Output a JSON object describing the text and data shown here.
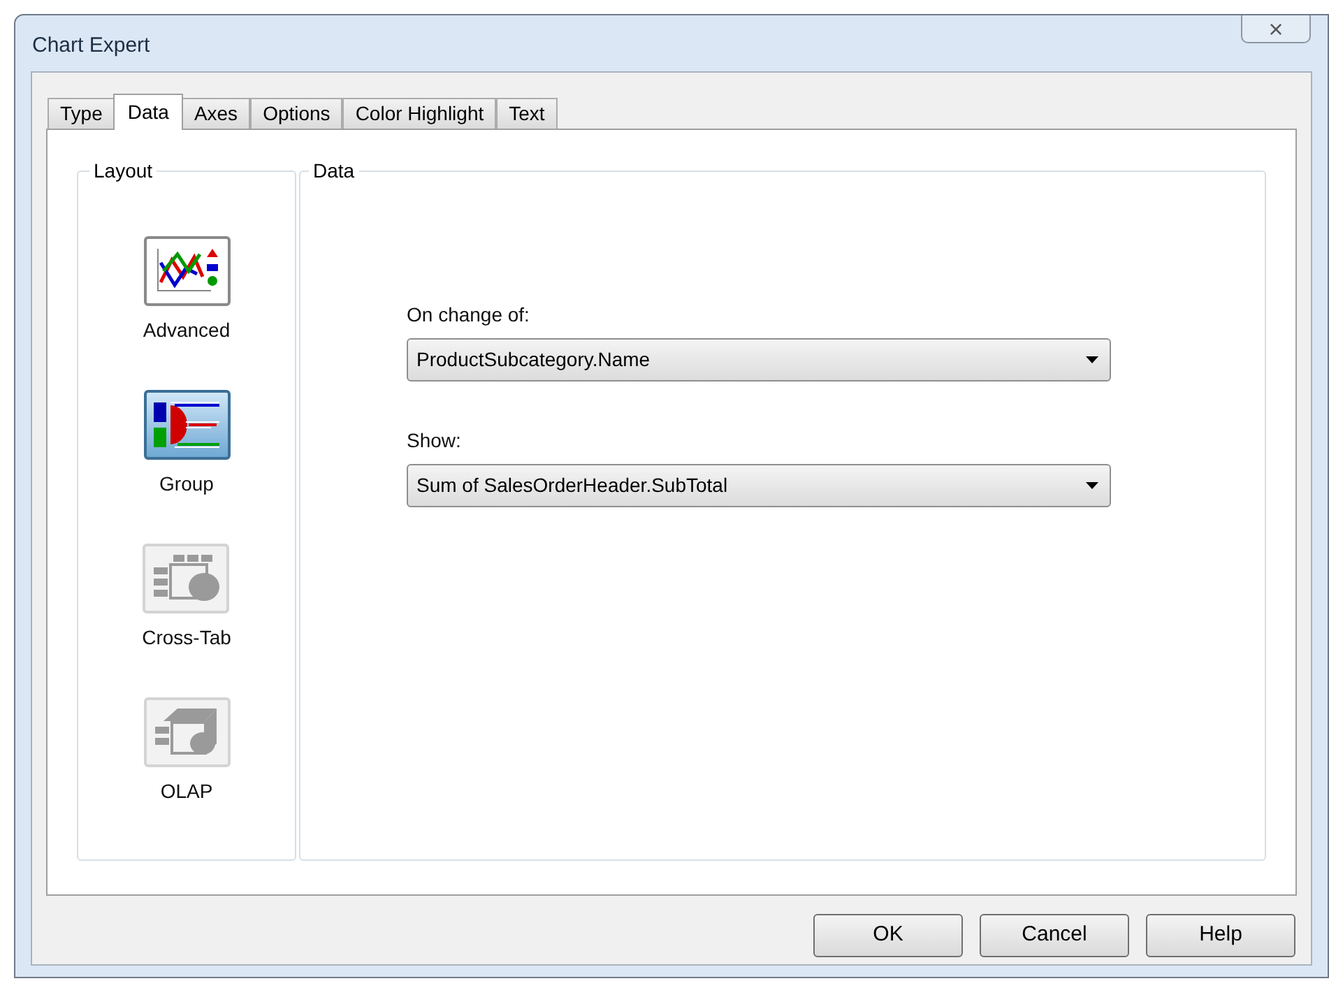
{
  "window": {
    "title": "Chart Expert",
    "close": "×"
  },
  "tabs": [
    {
      "label": "Type",
      "selected": false
    },
    {
      "label": "Data",
      "selected": true
    },
    {
      "label": "Axes",
      "selected": false
    },
    {
      "label": "Options",
      "selected": false
    },
    {
      "label": "Color Highlight",
      "selected": false
    },
    {
      "label": "Text",
      "selected": false
    }
  ],
  "layout": {
    "title": "Layout",
    "items": [
      {
        "kind": "advanced",
        "label": "Advanced",
        "selected": false,
        "disabled": false
      },
      {
        "kind": "group",
        "label": "Group",
        "selected": true,
        "disabled": false
      },
      {
        "kind": "crosstab",
        "label": "Cross-Tab",
        "selected": false,
        "disabled": true
      },
      {
        "kind": "olap",
        "label": "OLAP",
        "selected": false,
        "disabled": true
      }
    ]
  },
  "data": {
    "title": "Data",
    "fields": [
      {
        "label": "On change of:",
        "value": "ProductSubcategory.Name"
      },
      {
        "label": "Show:",
        "value": "Sum of SalesOrderHeader.SubTotal"
      }
    ]
  },
  "buttons": [
    "OK",
    "Cancel",
    "Help"
  ]
}
